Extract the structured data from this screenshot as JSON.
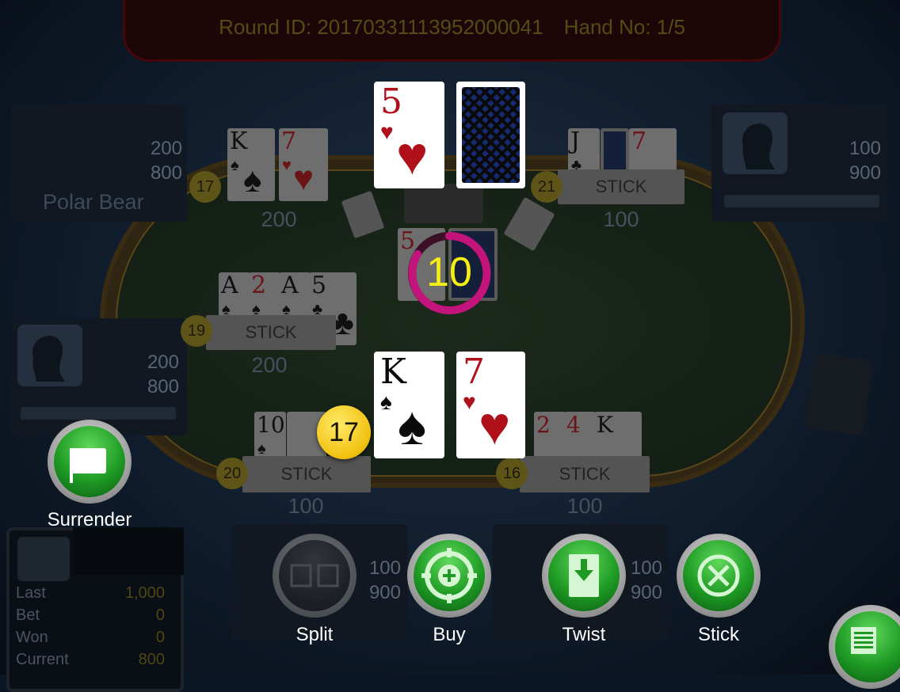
{
  "header": {
    "round_label": "Round ID: 20170331113952000041",
    "hand_label": "Hand No: 1/5"
  },
  "timer": {
    "value": "10"
  },
  "dealer": {
    "card1_rank": "5",
    "card1_suit": "♥"
  },
  "players": {
    "polar_bear": {
      "name": "Polar Bear",
      "num1": "200",
      "num2": "800",
      "score": "17",
      "bet": "200",
      "cards": [
        {
          "rank": "K",
          "suit": "♠"
        },
        {
          "rank": "7",
          "suit": "♥"
        }
      ]
    },
    "top_right": {
      "num1": "100",
      "num2": "900",
      "score": "21",
      "status": "STICK",
      "bet": "100",
      "cards": [
        {
          "rank": "J",
          "suit": "♣"
        },
        {
          "rank": "7",
          "suit": "♥"
        }
      ]
    },
    "left_mid": {
      "num1": "200",
      "num2": "800",
      "score": "19",
      "status": "STICK",
      "bet": "200",
      "cards": [
        {
          "rank": "A",
          "suit": "♠"
        },
        {
          "rank": "2",
          "suit": "♠"
        },
        {
          "rank": "A",
          "suit": "♠"
        },
        {
          "rank": "5",
          "suit": "♣"
        }
      ]
    },
    "bottom_left": {
      "num1": "100",
      "num2": "900",
      "score": "20",
      "status": "STICK",
      "bet": "100",
      "cards": [
        {
          "rank": "10",
          "suit": "♠"
        }
      ]
    },
    "bottom_right": {
      "num1": "100",
      "num2": "900",
      "score": "16",
      "status": "STICK",
      "bet": "100",
      "cards": [
        {
          "rank": "2",
          "suit": "♦"
        },
        {
          "rank": "4",
          "suit": "♦"
        },
        {
          "rank": "K",
          "suit": "♦"
        }
      ]
    }
  },
  "mid_cards": [
    {
      "rank": "5",
      "suit": "♥"
    }
  ],
  "my_hand": {
    "score": "17",
    "card1_rank": "K",
    "card1_suit": "♠",
    "card2_rank": "7",
    "card2_suit": "♥"
  },
  "actions": {
    "surrender": "Surrender",
    "split": "Split",
    "buy": "Buy",
    "twist": "Twist",
    "stick": "Stick"
  },
  "stats": {
    "last_label": "Last",
    "last_value": "1,000",
    "bet_label": "Bet",
    "bet_value": "0",
    "won_label": "Won",
    "won_value": "0",
    "current_label": "Current",
    "current_value": "800"
  },
  "colors": {
    "accent_green": "#1e9a24",
    "chip_yellow": "#f1c10e",
    "timer_ring": "#c2147a",
    "timer_text": "#f4ee12"
  },
  "icons": [
    "flag-icon",
    "split-icon",
    "buy-plus-icon",
    "twist-card-icon",
    "stick-x-icon",
    "menu-list-icon",
    "person-silhouette-icon"
  ]
}
